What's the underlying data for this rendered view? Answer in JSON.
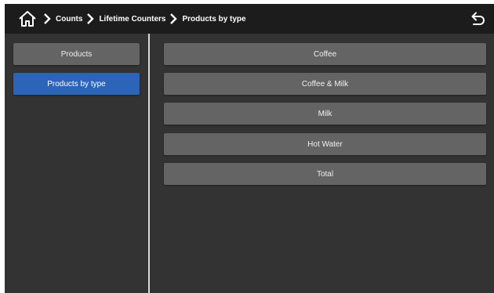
{
  "breadcrumb": {
    "items": [
      "Counts",
      "Lifetime Counters",
      "Products by type"
    ]
  },
  "icons": {
    "home": "home-icon",
    "separator": "chevron-right-icon",
    "back": "back-arrow-icon"
  },
  "sidebar": {
    "items": [
      {
        "label": "Products",
        "active": false
      },
      {
        "label": "Products by type",
        "active": true
      }
    ]
  },
  "main": {
    "items": [
      {
        "label": "Coffee"
      },
      {
        "label": "Coffee & Milk"
      },
      {
        "label": "Milk"
      },
      {
        "label": "Hot Water"
      },
      {
        "label": "Total"
      }
    ]
  },
  "colors": {
    "topbar": "#1c1c1c",
    "background": "#333333",
    "button": "#646464",
    "active": "#2c64b8",
    "text": "#ffffff"
  }
}
